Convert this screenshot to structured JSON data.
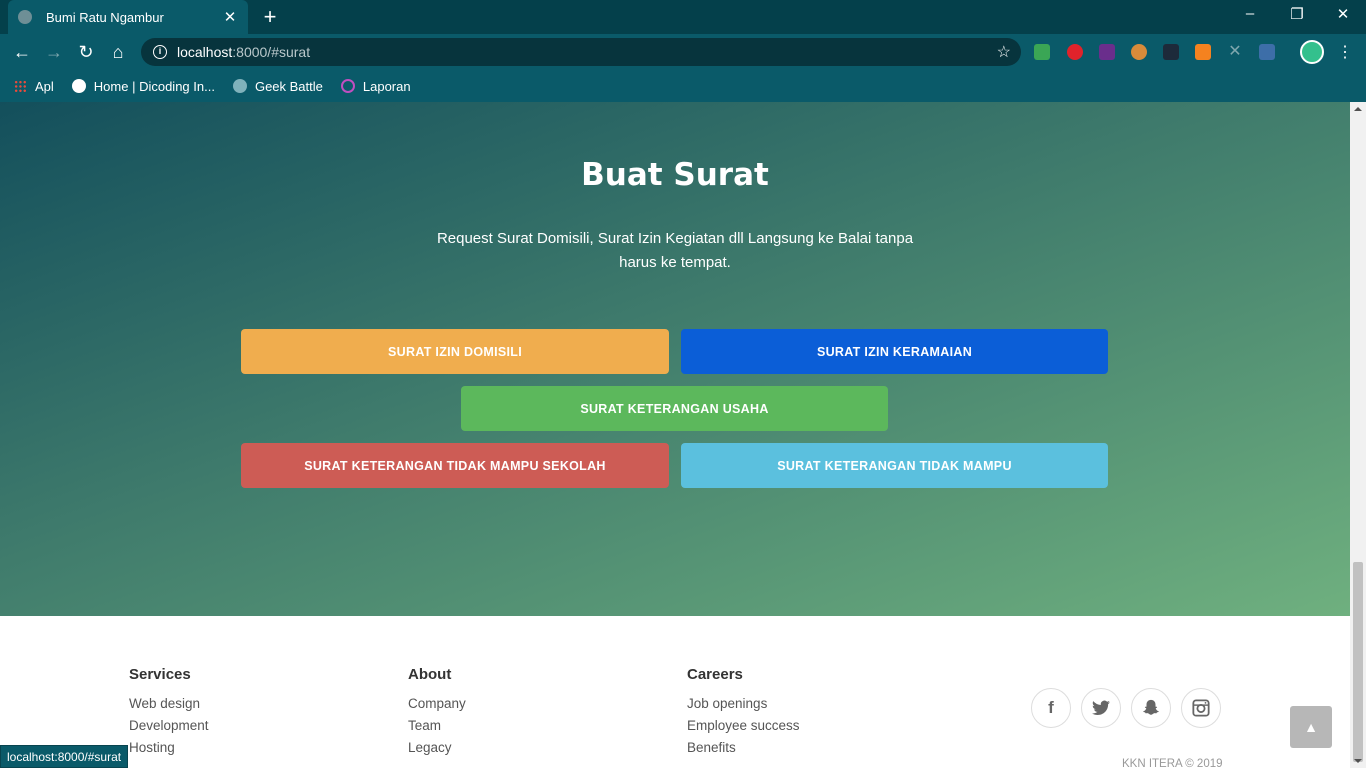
{
  "browser": {
    "tab_title": "Bumi Ratu Ngambur",
    "url_host": "localhost",
    "url_path": ":8000/#surat",
    "bookmarks": [
      "Apl",
      "Home | Dicoding In...",
      "Geek Battle",
      "Laporan"
    ],
    "status_url": "localhost:8000/#surat"
  },
  "hero": {
    "title": "Buat Surat",
    "description": "Request Surat Domisili, Surat Izin Kegiatan dll Langsung ke Balai tanpa harus ke tempat.",
    "buttons": [
      {
        "label": "SURAT IZIN DOMISILI",
        "color": "#f0ad4e"
      },
      {
        "label": "SURAT IZIN KERAMAIAN",
        "color": "#0b5ed7"
      },
      {
        "label": "SURAT KETERANGAN USAHA",
        "color": "#5cb85c"
      },
      {
        "label": "SURAT KETERANGAN TIDAK MAMPU SEKOLAH",
        "color": "#cd5c55"
      },
      {
        "label": "SURAT KETERANGAN TIDAK MAMPU",
        "color": "#5bc0de"
      }
    ]
  },
  "footer": {
    "columns": [
      {
        "heading": "Services",
        "links": [
          "Web design",
          "Development",
          "Hosting"
        ]
      },
      {
        "heading": "About",
        "links": [
          "Company",
          "Team",
          "Legacy"
        ]
      },
      {
        "heading": "Careers",
        "links": [
          "Job openings",
          "Employee success",
          "Benefits"
        ]
      }
    ],
    "social": [
      "facebook-icon",
      "twitter-icon",
      "snapchat-icon",
      "instagram-icon"
    ],
    "copyright": "KKN ITERA © 2019"
  }
}
